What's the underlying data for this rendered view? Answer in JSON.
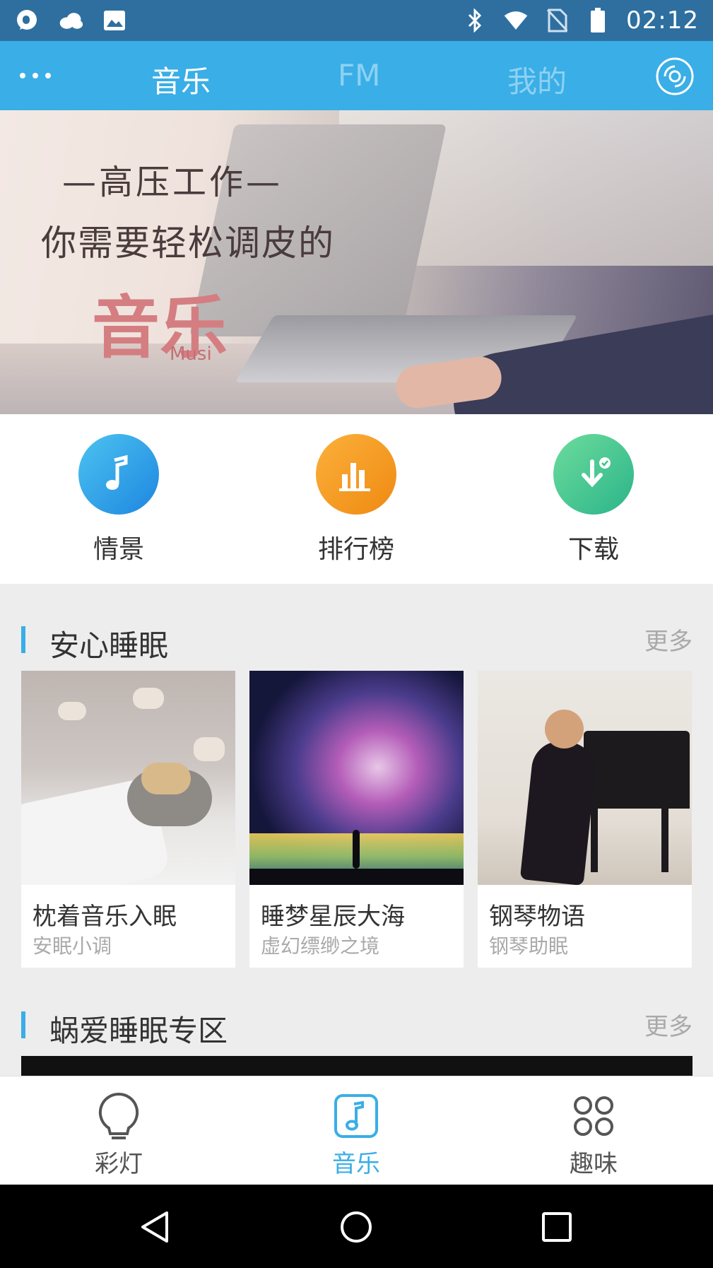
{
  "status_bar": {
    "time": "02:12",
    "left_icons": [
      "chat-icon",
      "cloud-icon",
      "image-icon"
    ],
    "right_icons": [
      "bluetooth-icon",
      "wifi-icon",
      "no-sim-icon",
      "battery-icon"
    ]
  },
  "header": {
    "tabs": [
      {
        "label": "音乐",
        "active": true
      },
      {
        "label": "FM",
        "active": false
      },
      {
        "label": "我的",
        "active": false
      }
    ],
    "colors": {
      "bar": "#3aaee6",
      "active_tab": "#ffffff",
      "inactive_tab": "#8ed1f3"
    }
  },
  "banner": {
    "line1": "—高压工作—",
    "line2": "你需要轻松调皮的",
    "logo_text": "音乐",
    "logo_sub": "Musi",
    "slide_count": 5,
    "active_slide": 2
  },
  "shortcuts": [
    {
      "label": "情景",
      "icon": "music-note-icon",
      "color": "#2b9be6"
    },
    {
      "label": "排行榜",
      "icon": "bar-chart-icon",
      "color": "#f29a1f"
    },
    {
      "label": "下载",
      "icon": "download-icon",
      "color": "#3ec18a"
    }
  ],
  "section_sleep": {
    "title": "安心睡眠",
    "more": "更多",
    "cards": [
      {
        "title": "枕着音乐入眠",
        "subtitle": "安眠小调"
      },
      {
        "title": "睡梦星辰大海",
        "subtitle": "虚幻缥缈之境"
      },
      {
        "title": "钢琴物语",
        "subtitle": "钢琴助眠"
      }
    ]
  },
  "section_zone": {
    "title": "蜗爱睡眠专区",
    "more": "更多"
  },
  "bottom_nav": {
    "items": [
      {
        "label": "彩灯",
        "icon": "light-bulb-icon",
        "active": false
      },
      {
        "label": "音乐",
        "icon": "music-note-icon",
        "active": true
      },
      {
        "label": "趣味",
        "icon": "apps-grid-icon",
        "active": false
      }
    ],
    "active_color": "#3aaee6",
    "inactive_color": "#555555"
  }
}
